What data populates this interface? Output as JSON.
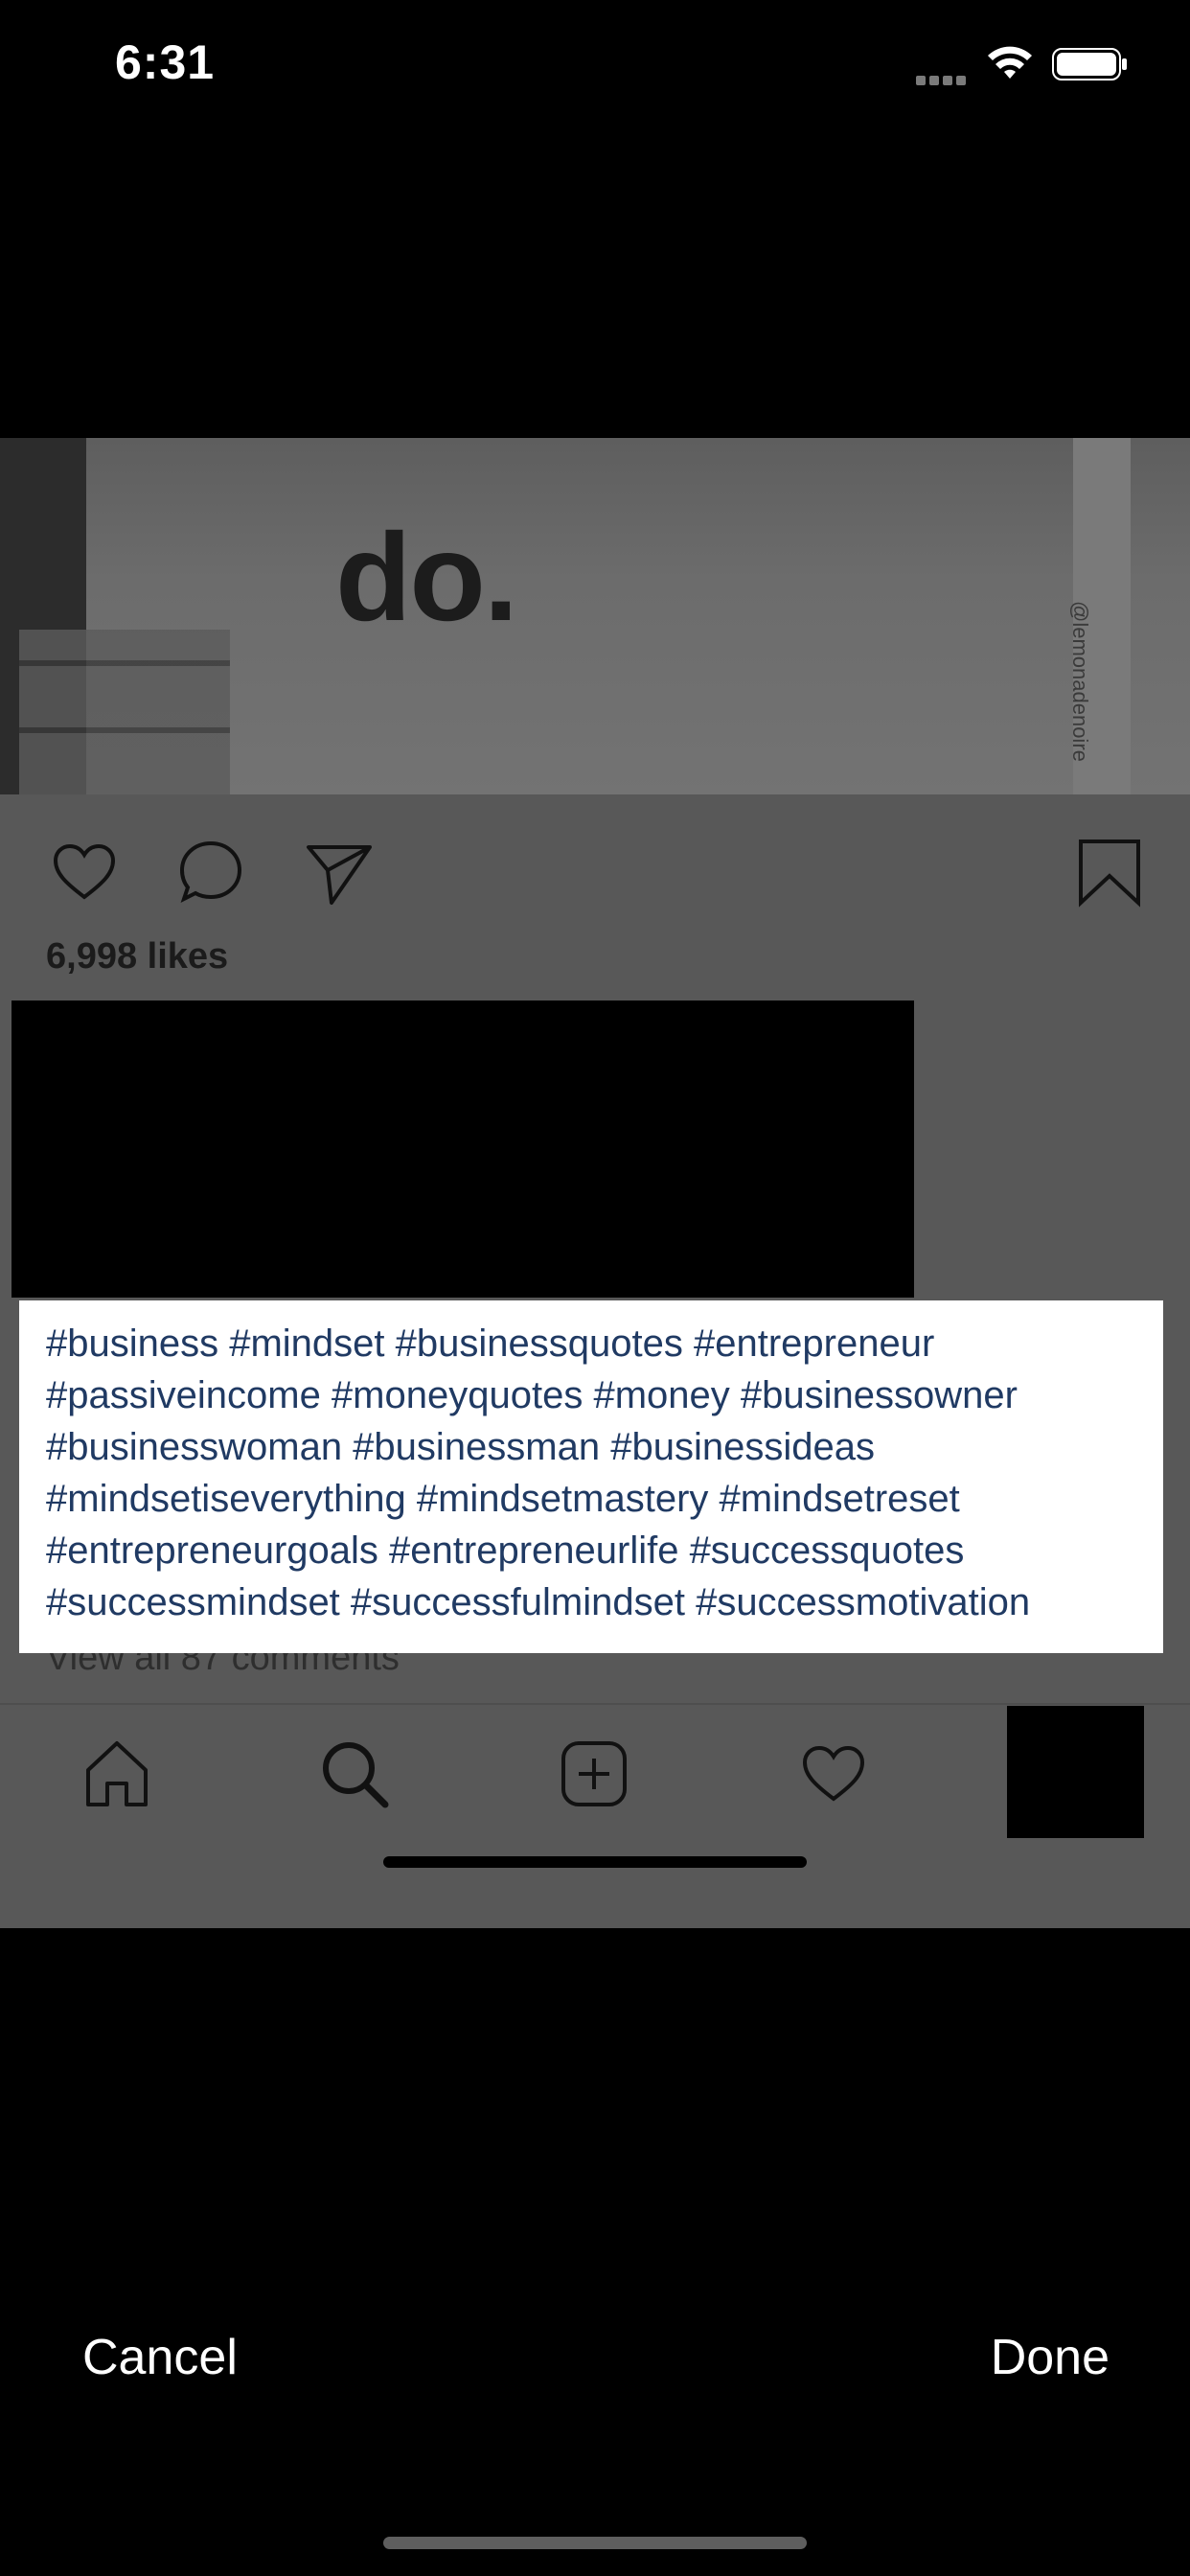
{
  "status": {
    "time": "6:31"
  },
  "post": {
    "image_text": "do.",
    "watermark": "@lemonadenoire",
    "likes": "6,998 likes",
    "view_comments": "View all 87 comments"
  },
  "caption": {
    "text": "#business #mindset #businessquotes #entrepreneur #passiveincome #moneyquotes #money #businessowner #businesswoman #businessman #businessideas #mindsetiseverything #mindsetmastery #mindsetreset #entrepreneurgoals #entrepreneurlife #successquotes #successmindset #successfulmindset #successmotivation"
  },
  "actions": {
    "cancel": "Cancel",
    "done": "Done"
  },
  "icons": [
    "heart-icon",
    "comment-icon",
    "share-icon",
    "bookmark-icon",
    "home-icon",
    "search-icon",
    "add-icon",
    "activity-heart-icon"
  ],
  "colors": {
    "caption_text": "#203a63",
    "caption_bg": "#ffffff",
    "overlay": "#585858"
  }
}
